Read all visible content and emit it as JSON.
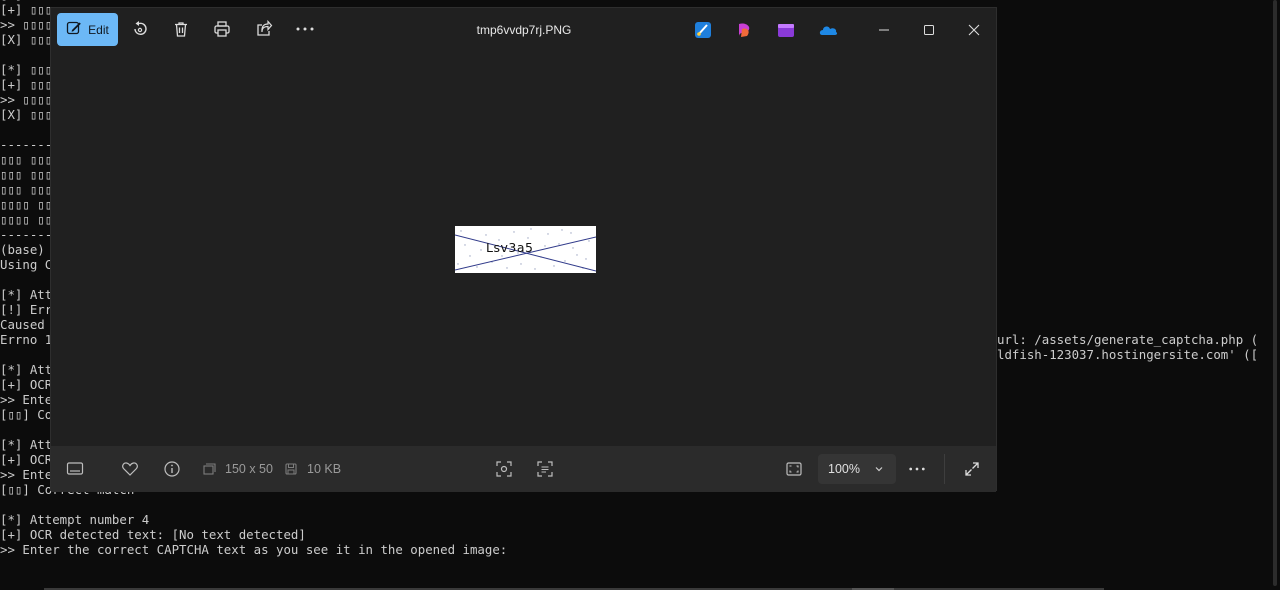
{
  "terminal": {
    "lines": [
      "[*] ▯▯▯",
      "[+] ▯▯▯",
      ">> ▯▯▯▯",
      "[X] ▯▯▯",
      "",
      "[*] ▯▯▯",
      "[+] ▯▯▯",
      ">> ▯▯▯▯",
      "[X] ▯▯▯",
      "",
      "--------",
      "▯▯▯ ▯▯▯",
      "▯▯▯ ▯▯▯",
      "▯▯▯ ▯▯▯",
      "▯▯▯▯ ▯▯",
      "▯▯▯▯ ▯▯",
      "--------",
      "(base)",
      "Using C",
      "",
      "[*] Att",
      "[!] Err",
      "Caused",
      "Errno 1",
      "",
      "[*] Att",
      "[+] OCR",
      ">> Ente",
      "[▯▯] Co",
      "",
      "[*] Att",
      "[+] OCR detected text: NJYLGA",
      ">> Enter the correct CAPTCHA text as you see it in the opened image: NJYLGA",
      "[▯▯] Correct match",
      "",
      "[*] Attempt number 4",
      "[+] OCR detected text: [No text detected]",
      ">> Enter the correct CAPTCHA text as you see it in the opened image:"
    ],
    "right_lines": [
      "url: /assets/generate_captcha.php (",
      "ldfish-123037.hostingersite.com' (["
    ]
  },
  "viewer": {
    "edit_label": "Edit",
    "title": "tmp6vvdp7rj.PNG",
    "captcha_text": "Lsv3a5",
    "dimensions": "150 x 50",
    "file_size": "10 KB",
    "zoom": "100%",
    "icons": {
      "edit": "edit-pencil-icon",
      "rotate": "rotate-icon",
      "delete": "trash-icon",
      "print": "printer-icon",
      "share": "share-icon",
      "more": "more-icon",
      "filmstrip": "filmstrip-icon",
      "favorite": "heart-icon",
      "info": "info-icon",
      "fit": "fit-to-window-icon",
      "fullscreen": "fullscreen-icon"
    },
    "colors": {
      "accent": "#6cb8f6",
      "window_bg": "#202020",
      "statusbar_bg": "#2b2b2b",
      "terminal_bg": "#0c0c0c"
    }
  }
}
